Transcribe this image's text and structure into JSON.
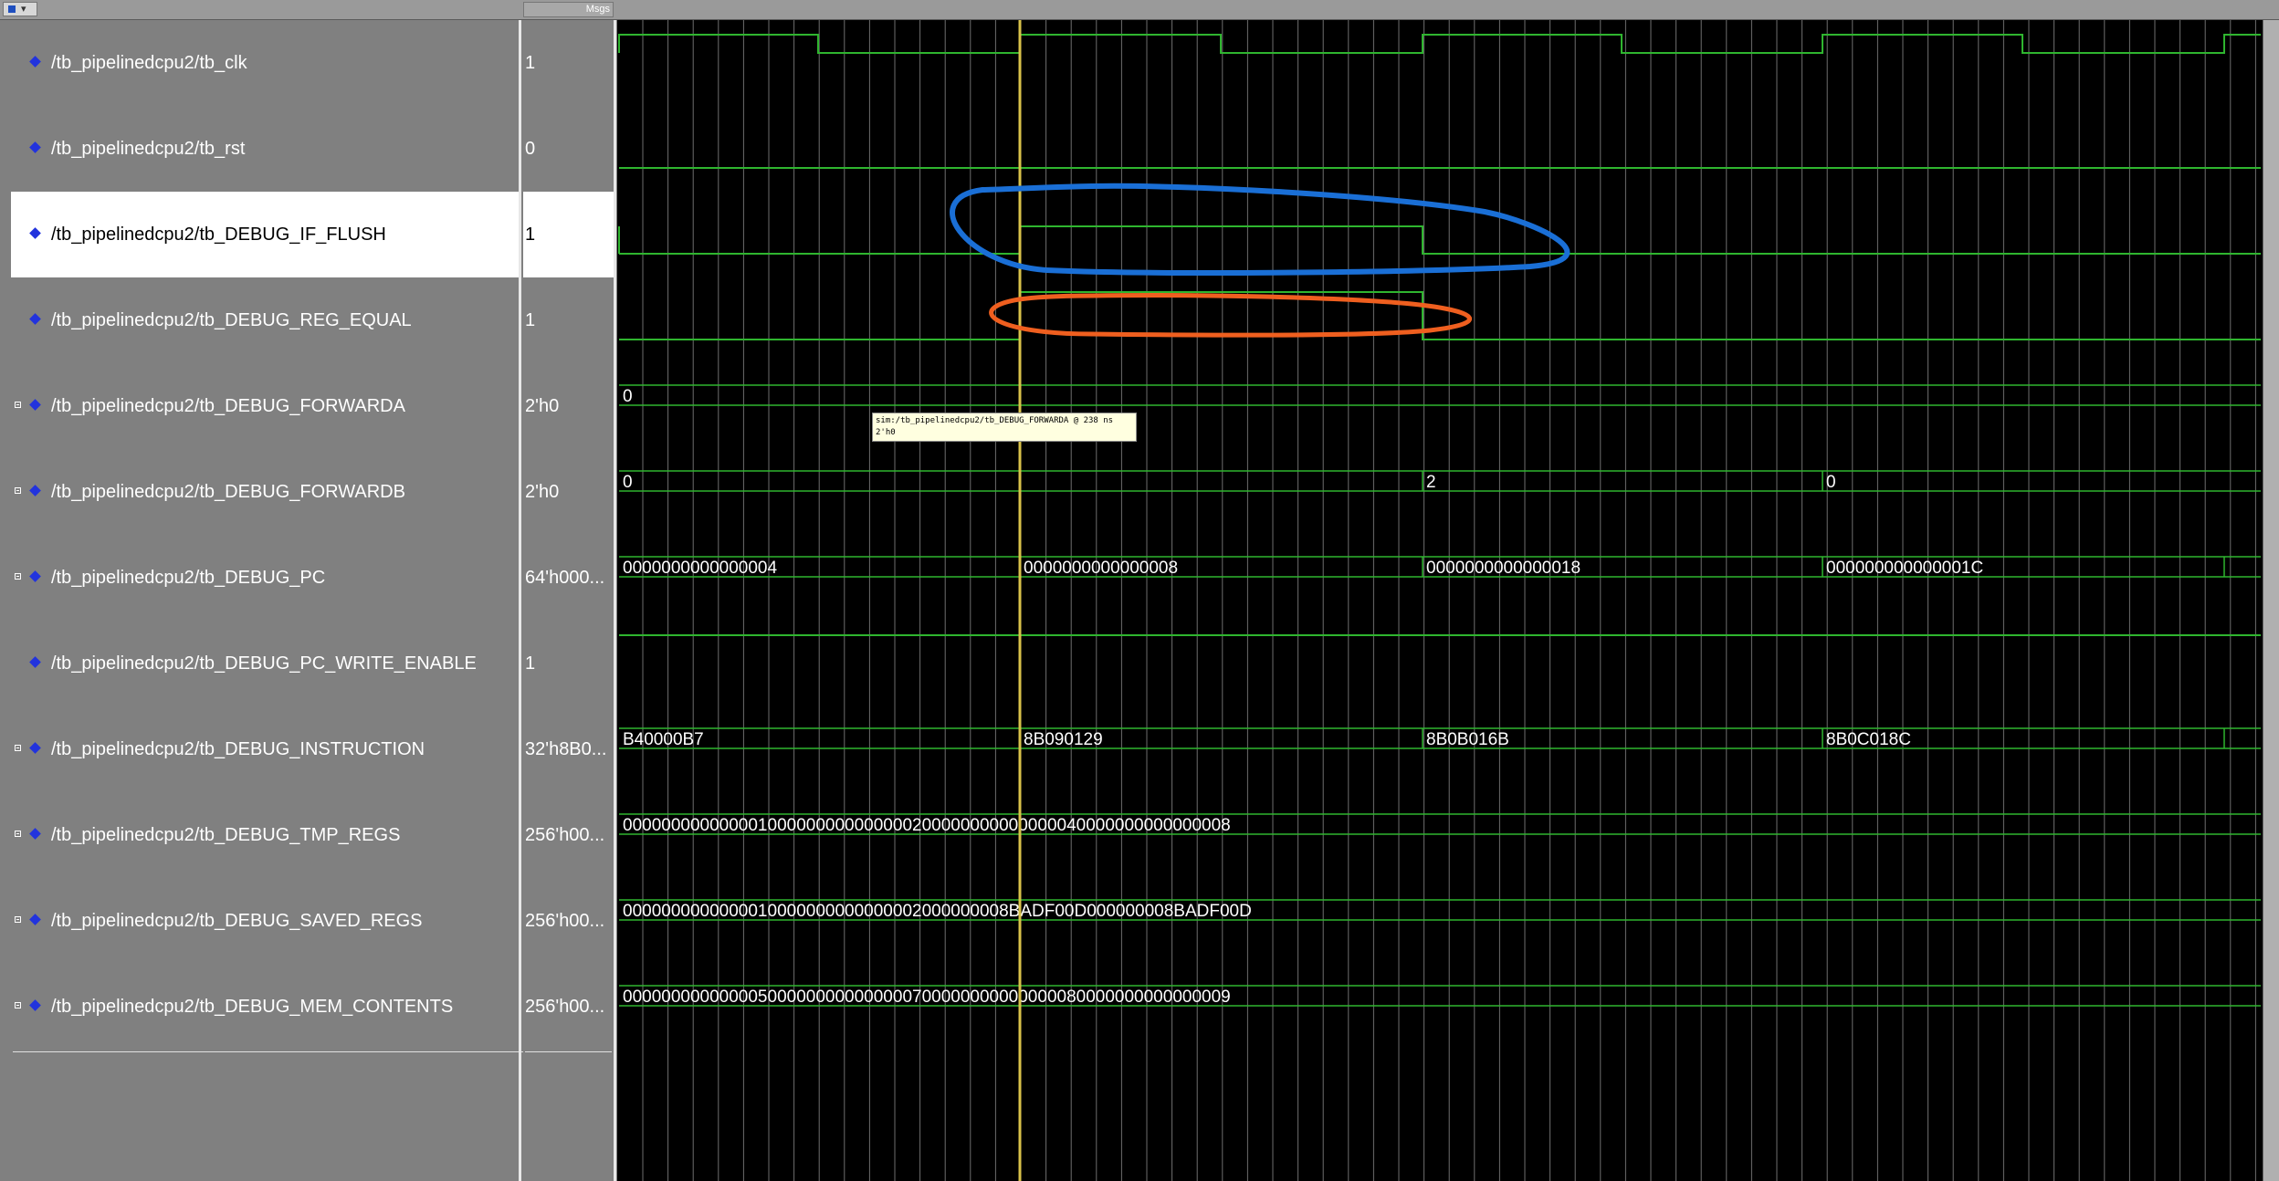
{
  "header": {
    "msgs_label": "Msgs"
  },
  "signals": [
    {
      "name": "/tb_pipelinedcpu2/tb_clk",
      "value": "1",
      "bus": false,
      "selected": false
    },
    {
      "name": "/tb_pipelinedcpu2/tb_rst",
      "value": "0",
      "bus": false,
      "selected": false
    },
    {
      "name": "/tb_pipelinedcpu2/tb_DEBUG_IF_FLUSH",
      "value": "1",
      "bus": false,
      "selected": true
    },
    {
      "name": "/tb_pipelinedcpu2/tb_DEBUG_REG_EQUAL",
      "value": "1",
      "bus": false,
      "selected": false
    },
    {
      "name": "/tb_pipelinedcpu2/tb_DEBUG_FORWARDA",
      "value": "2'h0",
      "bus": true,
      "selected": false
    },
    {
      "name": "/tb_pipelinedcpu2/tb_DEBUG_FORWARDB",
      "value": "2'h0",
      "bus": true,
      "selected": false
    },
    {
      "name": "/tb_pipelinedcpu2/tb_DEBUG_PC",
      "value": "64'h000...",
      "bus": true,
      "selected": false
    },
    {
      "name": "/tb_pipelinedcpu2/tb_DEBUG_PC_WRITE_ENABLE",
      "value": "1",
      "bus": false,
      "selected": false
    },
    {
      "name": "/tb_pipelinedcpu2/tb_DEBUG_INSTRUCTION",
      "value": "32'h8B0...",
      "bus": true,
      "selected": false
    },
    {
      "name": "/tb_pipelinedcpu2/tb_DEBUG_TMP_REGS",
      "value": "256'h00...",
      "bus": true,
      "selected": false
    },
    {
      "name": "/tb_pipelinedcpu2/tb_DEBUG_SAVED_REGS",
      "value": "256'h00...",
      "bus": true,
      "selected": false
    },
    {
      "name": "/tb_pipelinedcpu2/tb_DEBUG_MEM_CONTENTS",
      "value": "256'h00...",
      "bus": true,
      "selected": false
    }
  ],
  "waves": {
    "forwarda": [
      "0"
    ],
    "forwardb": [
      "0",
      "2",
      "0"
    ],
    "pc": [
      "0000000000000004",
      "0000000000000008",
      "0000000000000018",
      "000000000000001C"
    ],
    "instruction": [
      "B40000B7",
      "8B090129",
      "8B0B016B",
      "8B0C018C"
    ],
    "tmp_regs": "000000000000001000000000000000200000000000000040000000000000008",
    "saved_regs": "0000000000000010000000000000002000000008BADF00D000000008BADF00D",
    "mem_contents": "000000000000005000000000000000700000000000000080000000000000009"
  },
  "tooltip": {
    "line1": "sim:/tb_pipelinedcpu2/tb_DEBUG_FORWARDA @ 238 ns",
    "line2": "2'h0"
  },
  "colors": {
    "wave": "#2fb52f",
    "cursor": "#d9c24a",
    "grid": "#6e6e6e",
    "annotation_blue": "#1a6fd6",
    "annotation_orange": "#ef5f1f"
  }
}
